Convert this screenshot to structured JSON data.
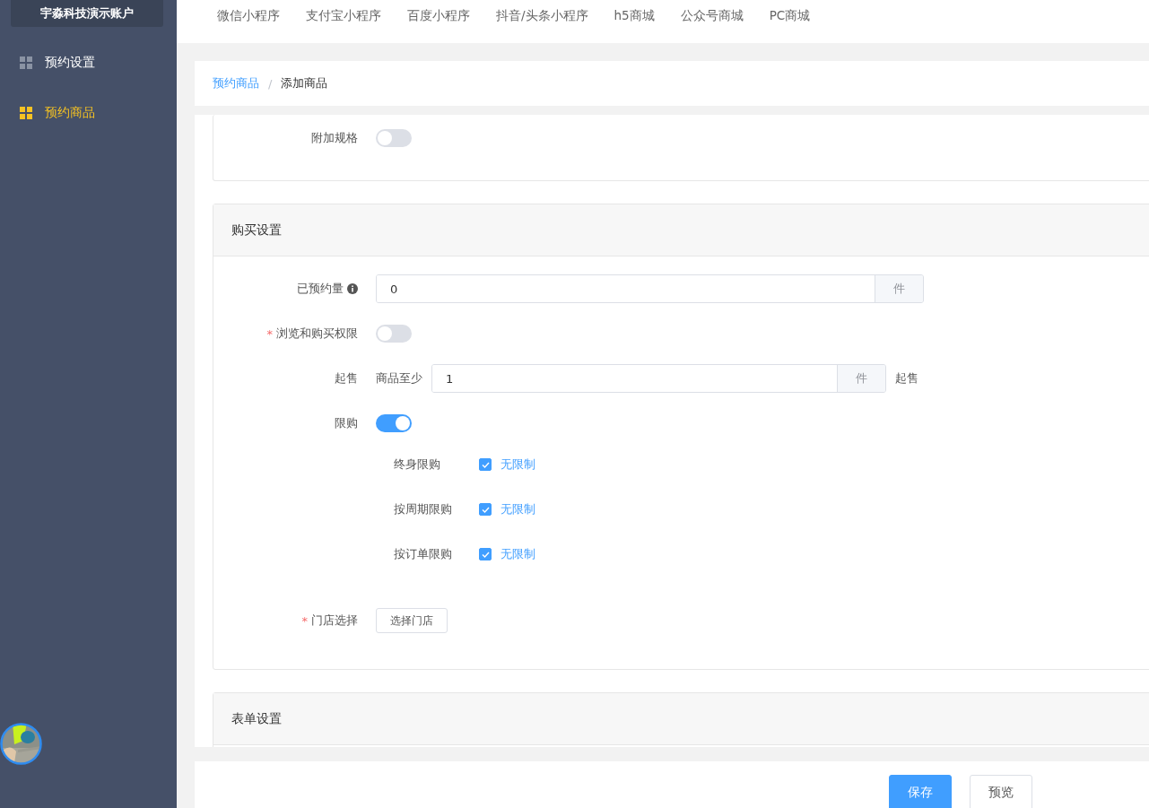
{
  "sidebar": {
    "account": "宇淼科技演示账户",
    "items": [
      {
        "label": "预约设置",
        "selected": false
      },
      {
        "label": "预约商品",
        "selected": true
      }
    ]
  },
  "top_nav": {
    "items": [
      "微信小程序",
      "支付宝小程序",
      "百度小程序",
      "抖音/头条小程序",
      "h5商城",
      "公众号商城",
      "PC商城"
    ]
  },
  "breadcrumb": {
    "items": [
      "预约商品",
      "添加商品"
    ],
    "separator": "/"
  },
  "form": {
    "extra_spec": {
      "label": "附加规格",
      "on": false
    },
    "purchase_settings": {
      "title": "购买设置",
      "fields": [
        {
          "kind": "input",
          "label": "已预约量",
          "info": true,
          "value": "0",
          "suffix": "件"
        },
        {
          "kind": "switch",
          "label": "浏览和购买权限",
          "required_mark": "*",
          "on": false
        },
        {
          "kind": "prefixed_input",
          "label": "起售",
          "prefix": "商品至少",
          "value": "1",
          "suffix": "件",
          "after": "起售"
        },
        {
          "kind": "limit",
          "label": "限购",
          "on": true,
          "options": [
            {
              "label": "终身限购",
              "checked": true,
              "text": "无限制"
            },
            {
              "label": "按周期限购",
              "checked": true,
              "text": "无限制"
            },
            {
              "label": "按订单限购",
              "checked": true,
              "text": "无限制"
            }
          ]
        },
        {
          "kind": "button",
          "label": "门店选择",
          "required_mark": "*",
          "button": "选择门店"
        }
      ]
    },
    "form_settings": {
      "title": "表单设置"
    }
  },
  "buttons": [
    {
      "label": "保存",
      "kind": "primary"
    },
    {
      "label": "预览",
      "kind": "default"
    }
  ]
}
